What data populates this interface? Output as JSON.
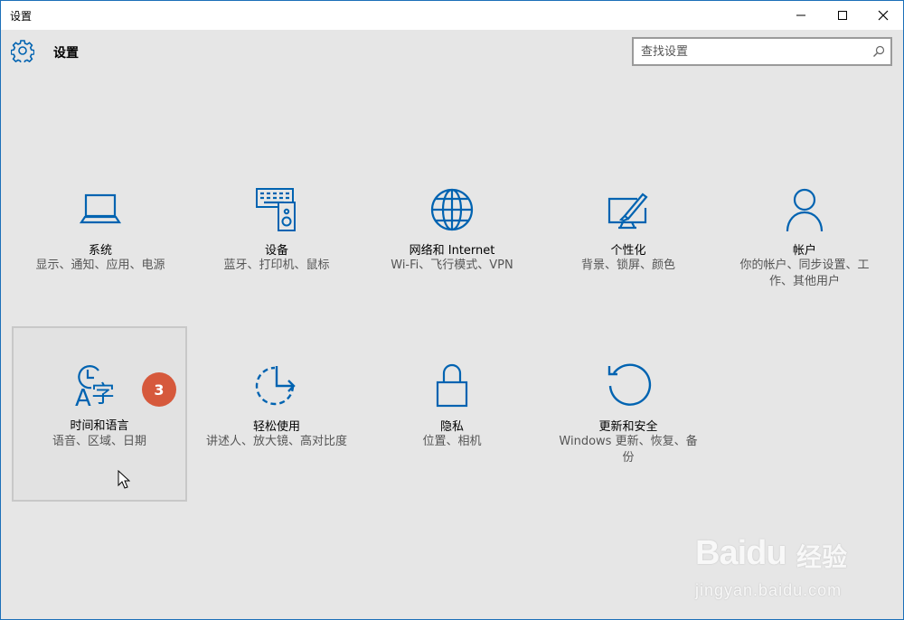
{
  "window": {
    "title": "设置",
    "controls": [
      "minimize",
      "maximize",
      "close"
    ]
  },
  "header": {
    "title": "设置",
    "search_placeholder": "查找设置"
  },
  "tiles": [
    {
      "label": "系统",
      "desc": "显示、通知、应用、电源",
      "icon": "laptop-icon"
    },
    {
      "label": "设备",
      "desc": "蓝牙、打印机、鼠标",
      "icon": "devices-icon"
    },
    {
      "label": "网络和 Internet",
      "desc": "Wi-Fi、飞行模式、VPN",
      "icon": "globe-icon"
    },
    {
      "label": "个性化",
      "desc": "背景、锁屏、颜色",
      "icon": "personalization-icon"
    },
    {
      "label": "帐户",
      "desc": "你的帐户、同步设置、工作、其他用户",
      "icon": "person-icon"
    },
    {
      "label": "时间和语言",
      "desc": "语音、区域、日期",
      "icon": "time-language-icon"
    },
    {
      "label": "轻松使用",
      "desc": "讲述人、放大镜、高对比度",
      "icon": "ease-of-access-icon"
    },
    {
      "label": "隐私",
      "desc": "位置、相机",
      "icon": "lock-icon"
    },
    {
      "label": "更新和安全",
      "desc": "Windows 更新、恢复、备份",
      "icon": "update-icon"
    }
  ],
  "badge": "3",
  "watermark": {
    "brand": "Baidu",
    "cn": "经验",
    "url": "jingyan.baidu.com"
  },
  "colors": {
    "accent": "#0063b1",
    "background": "#e6e6e6",
    "badge": "#d6593c"
  }
}
